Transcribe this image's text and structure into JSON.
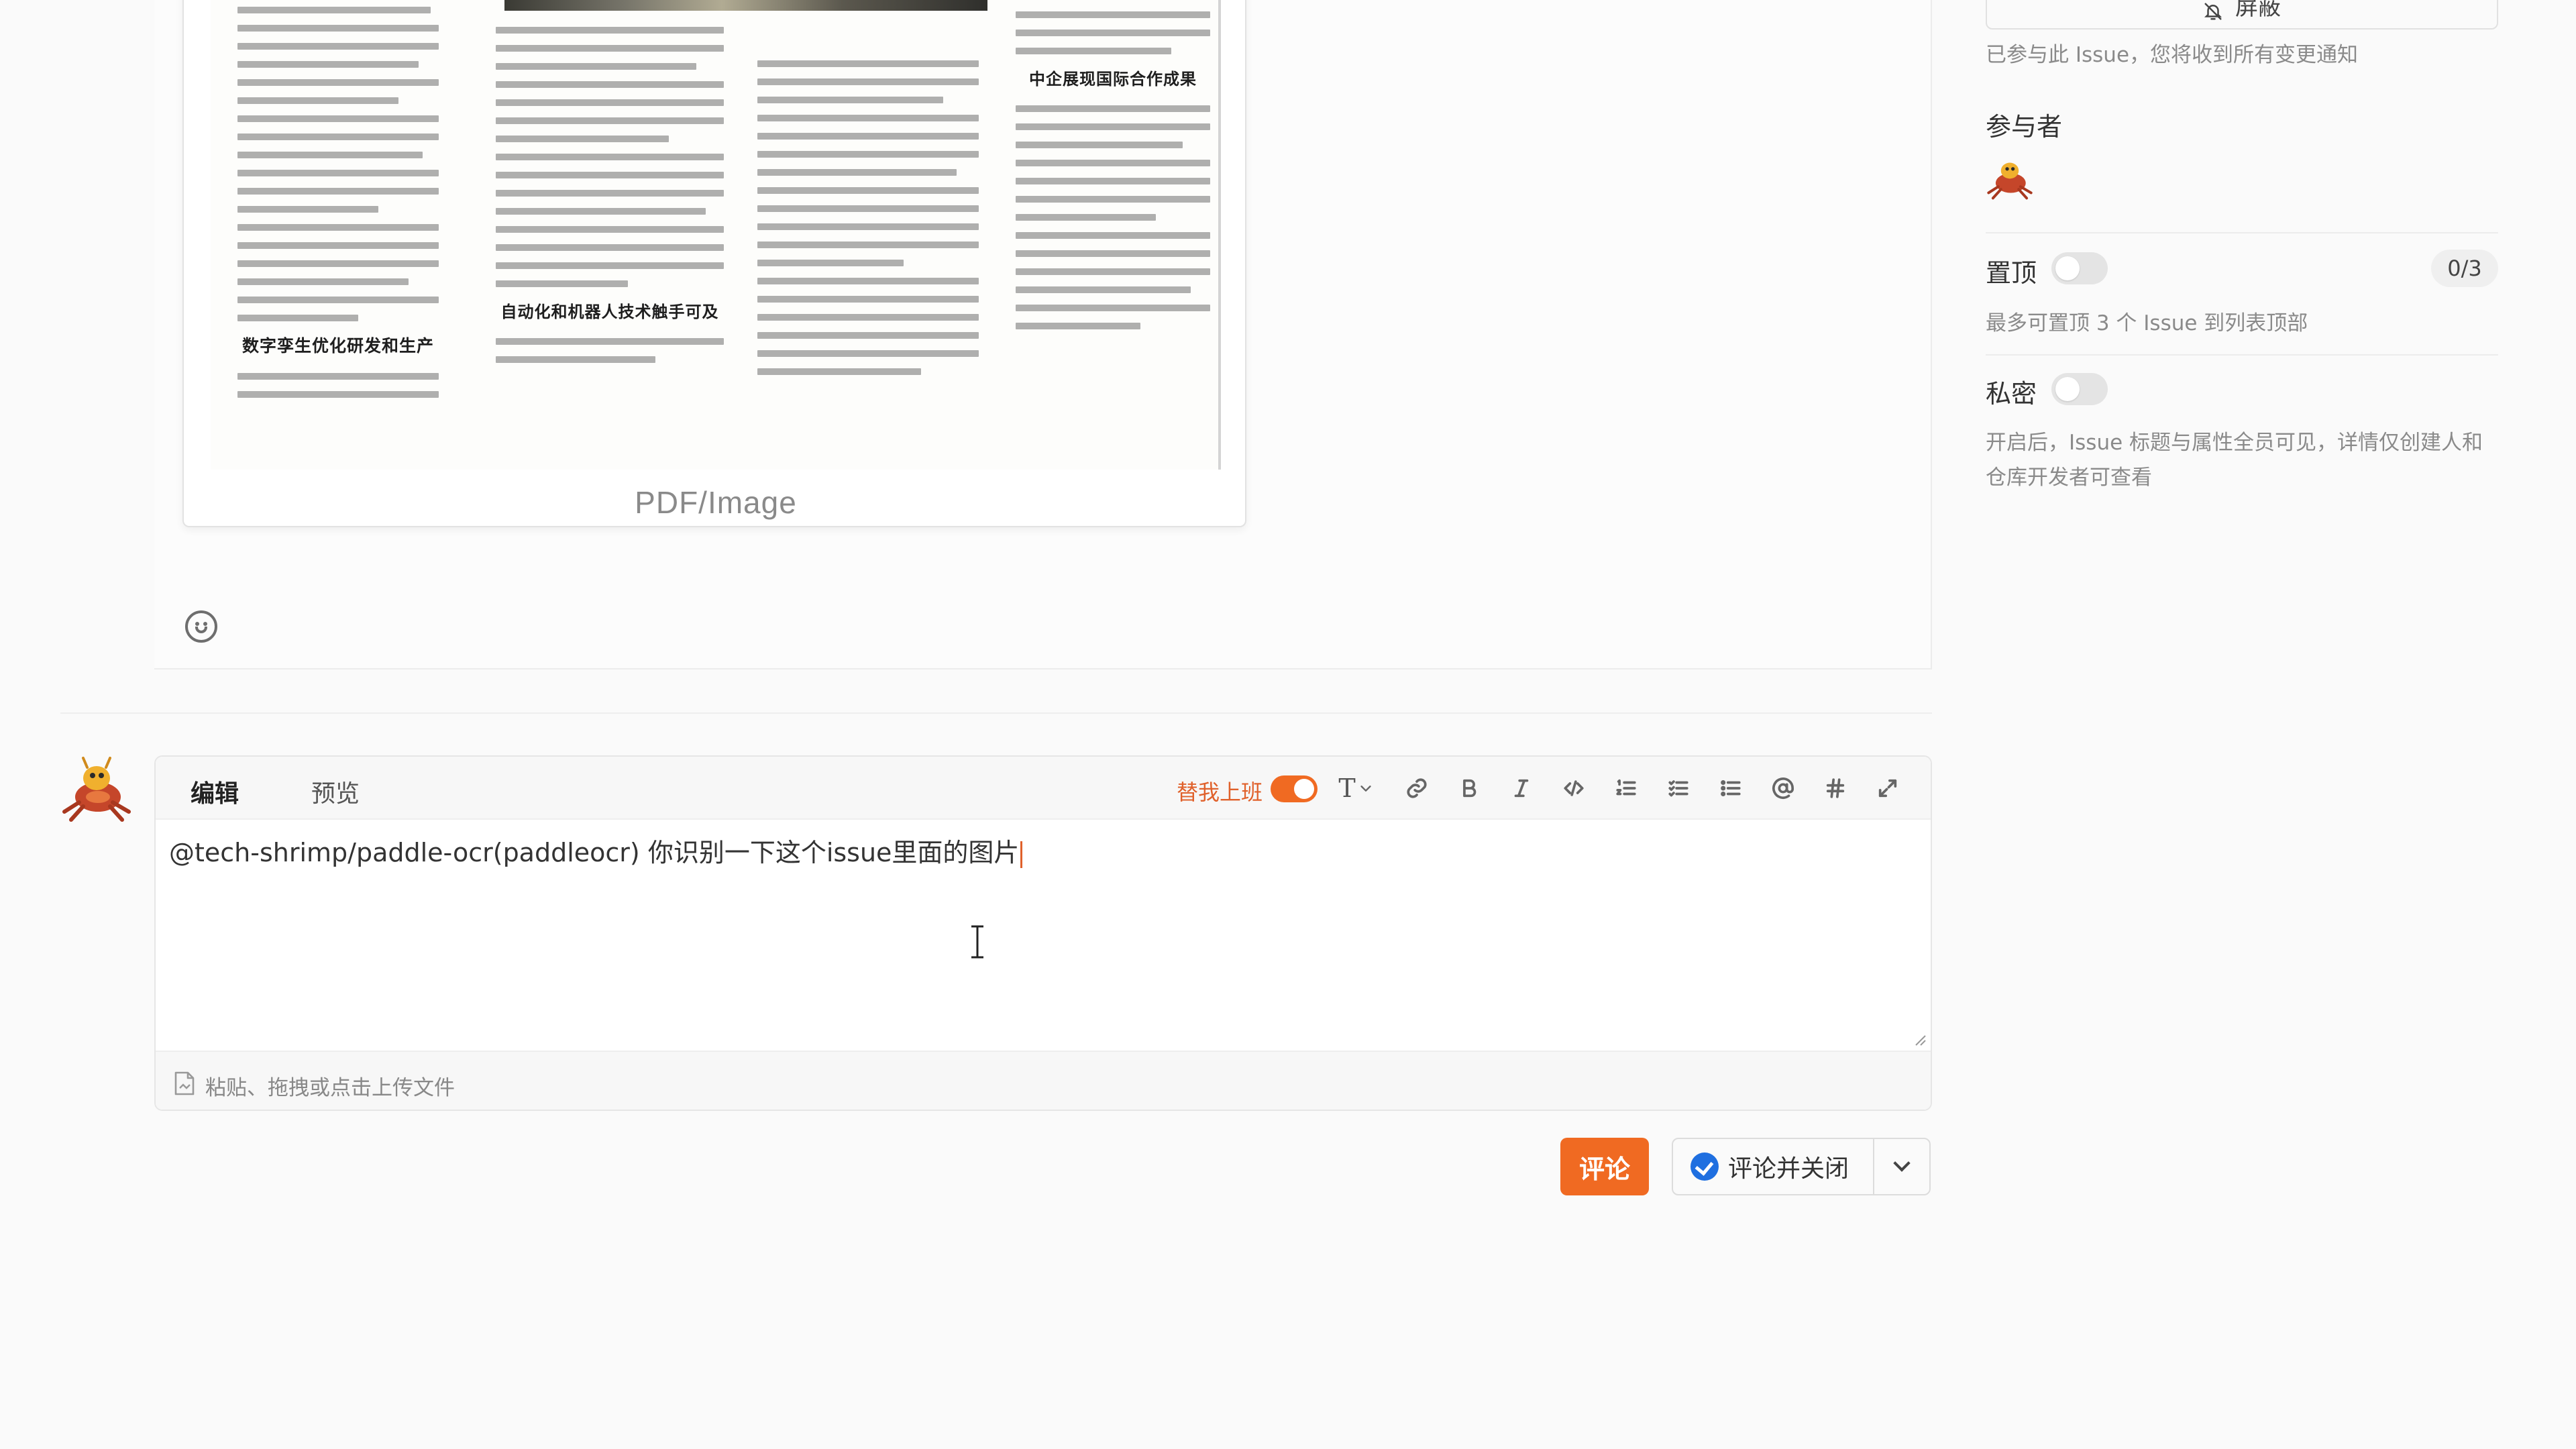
{
  "attachment": {
    "newspaper_headings": [
      "数字孪生优化研发和生产",
      "自动化和机器人技术触手可及",
      "中企展现国际合作成果"
    ],
    "type_label": "PDF/Image"
  },
  "editor": {
    "tabs": [
      "编辑",
      "预览"
    ],
    "active_tab": "编辑",
    "notify_toggle_label": "替我上班",
    "notify_toggle_on": true,
    "content": "@tech-shrimp/paddle-ocr(paddleocr)  你识别一下这个issue里面的图片",
    "toolbar_tools": [
      "heading",
      "link",
      "bold",
      "italic",
      "code",
      "ordered-list",
      "task-list",
      "bullet-list",
      "mention",
      "hashtag",
      "fullscreen"
    ],
    "heading_glyph": "T",
    "upload_hint": "粘贴、拖拽或点击上传文件"
  },
  "actions": {
    "comment_label": "评论",
    "comment_close_label": "评论并关闭"
  },
  "sidebar": {
    "mute_label": "屏蔽",
    "mute_note": "已参与此 Issue，您将收到所有变更通知",
    "participants_title": "参与者",
    "pin": {
      "title": "置顶",
      "enabled": false,
      "count": "0/3",
      "note": "最多可置顶 3 个 Issue 到列表顶部"
    },
    "private": {
      "title": "私密",
      "enabled": false,
      "note": "开启后，Issue 标题与属性全员可见，详情仅创建人和仓库开发者可查看"
    }
  },
  "colors": {
    "accent": "#f06a22",
    "primary_blue": "#1f6fe0"
  }
}
